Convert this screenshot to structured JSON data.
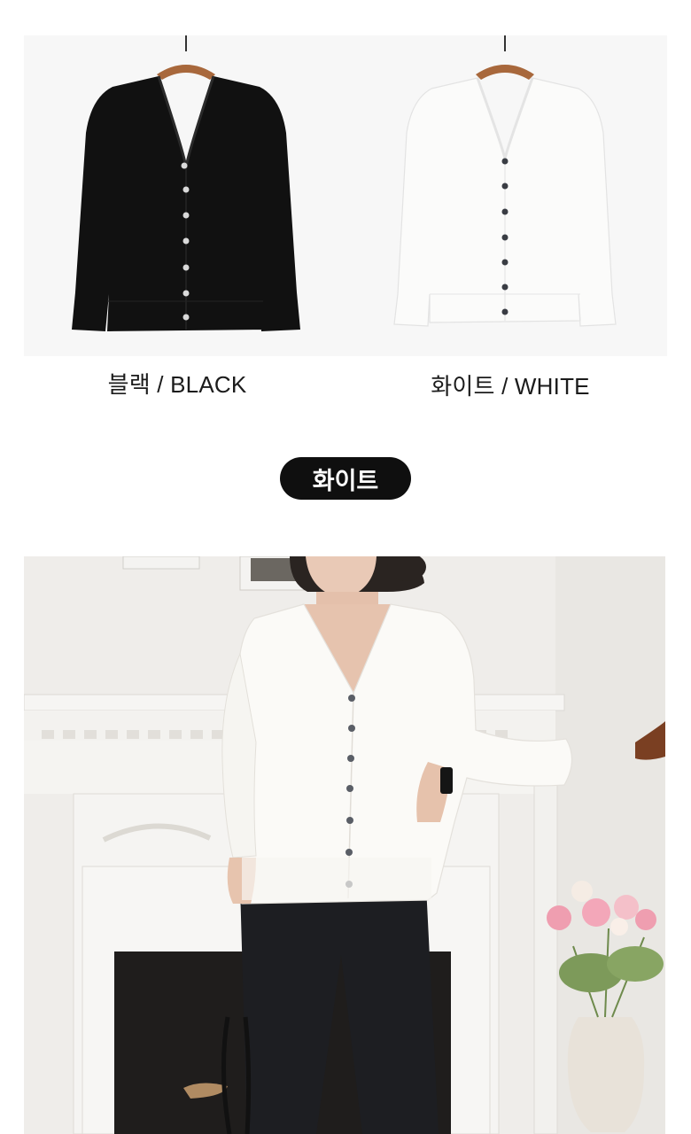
{
  "product_panel": {
    "items": [
      {
        "color_label": "블랙 / BLACK",
        "color_hex": "#111111"
      },
      {
        "color_label": "화이트 / WHITE",
        "color_hex": "#f8f8f6"
      }
    ]
  },
  "section_tag": {
    "label": "화이트"
  },
  "colors": {
    "pill_bg": "#0f0f0f",
    "panel_bg": "#f7f7f7",
    "hanger_wood": "#a8683c"
  }
}
